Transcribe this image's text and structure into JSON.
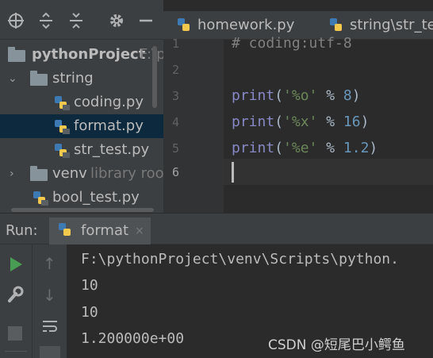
{
  "project_toolbar": {
    "icons": [
      "crosshair-icon",
      "expand-all-icon",
      "collapse-all-icon",
      "gear-icon",
      "minimize-icon"
    ]
  },
  "tree": {
    "root_label": "pythonProject",
    "root_path": "F:\\p",
    "items": [
      {
        "label": "string",
        "kind": "folder",
        "expanded": true
      },
      {
        "label": "coding.py",
        "kind": "python-file"
      },
      {
        "label": "format.py",
        "kind": "python-file",
        "selected": true
      },
      {
        "label": "str_test.py",
        "kind": "python-file"
      },
      {
        "label": "venv",
        "kind": "folder",
        "expanded": false,
        "hint": "library roo"
      },
      {
        "label": "bool_test.py",
        "kind": "python-file"
      }
    ]
  },
  "editor": {
    "tabs": [
      {
        "label": "homework.py"
      },
      {
        "label": "string\\str_te"
      }
    ],
    "line_numbers": [
      "1",
      "2",
      "3",
      "4",
      "5",
      "6"
    ],
    "lines": [
      {
        "comment": "# coding:utf-8"
      },
      {},
      {
        "keyword": "print",
        "open": "(",
        "string": "'%o'",
        "op": " % ",
        "number": "8",
        "close": ")"
      },
      {
        "keyword": "print",
        "open": "(",
        "string": "'%x'",
        "op": " % ",
        "number": "16",
        "close": ")"
      },
      {
        "keyword": "print",
        "open": "(",
        "string": "'%e'",
        "op": " % ",
        "number": "1.2",
        "close": ")"
      },
      {}
    ]
  },
  "run": {
    "label": "Run:",
    "tab_label": "format",
    "tab_close": "×",
    "output": [
      "F:\\pythonProject\\venv\\Scripts\\python.",
      "10",
      "10",
      "1.200000e+00"
    ]
  },
  "watermark": "CSDN @短尾巴小鳄鱼",
  "colors": {
    "keyword": "#8888c6",
    "string": "#6a8759",
    "number": "#6897bb",
    "selection": "#0d293e",
    "run_green": "#499c54"
  }
}
